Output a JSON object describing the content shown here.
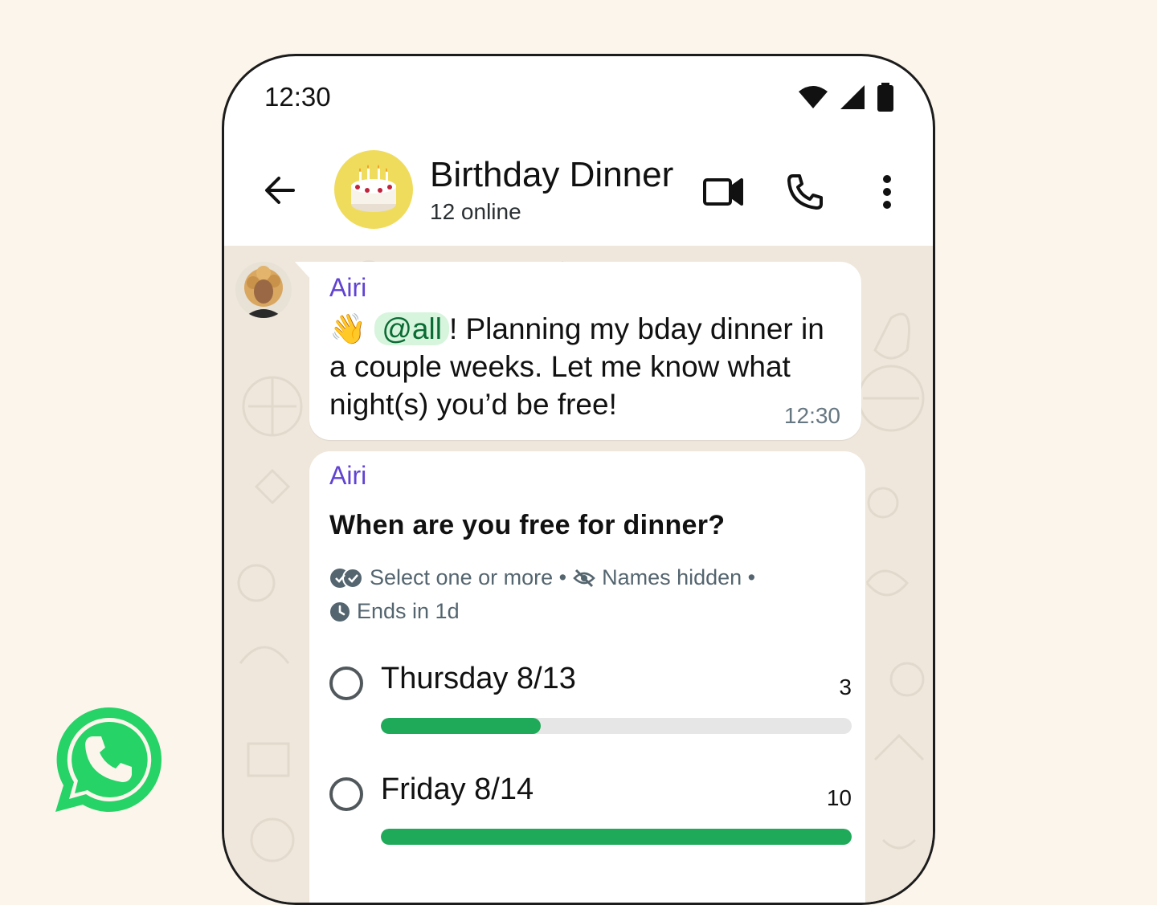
{
  "status": {
    "time": "12:30"
  },
  "header": {
    "title": "Birthday Dinner",
    "subtitle": "12 online",
    "avatar_emoji": "🎂"
  },
  "messages": [
    {
      "sender": "Airi",
      "emoji": "👋",
      "mention": "@all",
      "text": "! Planning my bday dinner in a couple weeks. Let me know what night(s) you’d be free!",
      "time": "12:30"
    }
  ],
  "poll": {
    "sender": "Airi",
    "question": "When are you free for dinner?",
    "select_hint": "Select one or more •",
    "names_hint": "Names hidden •",
    "ends": "Ends in 1d",
    "max_votes": 10,
    "options": [
      {
        "label": "Thursday 8/13",
        "votes": "3",
        "fraction": 0.34
      },
      {
        "label": "Friday 8/14",
        "votes": "10",
        "fraction": 1.0
      }
    ]
  },
  "colors": {
    "background": "#fcf5eb",
    "brand_green": "#25d366",
    "bar_green": "#1faa59",
    "sender_purple": "#6043d1"
  },
  "icons": [
    "wifi-icon",
    "signal-icon",
    "battery-icon",
    "back-arrow-icon",
    "video-call-icon",
    "phone-icon",
    "more-vert-icon",
    "double-check-icon",
    "eye-off-icon",
    "clock-icon",
    "whatsapp-logo"
  ]
}
